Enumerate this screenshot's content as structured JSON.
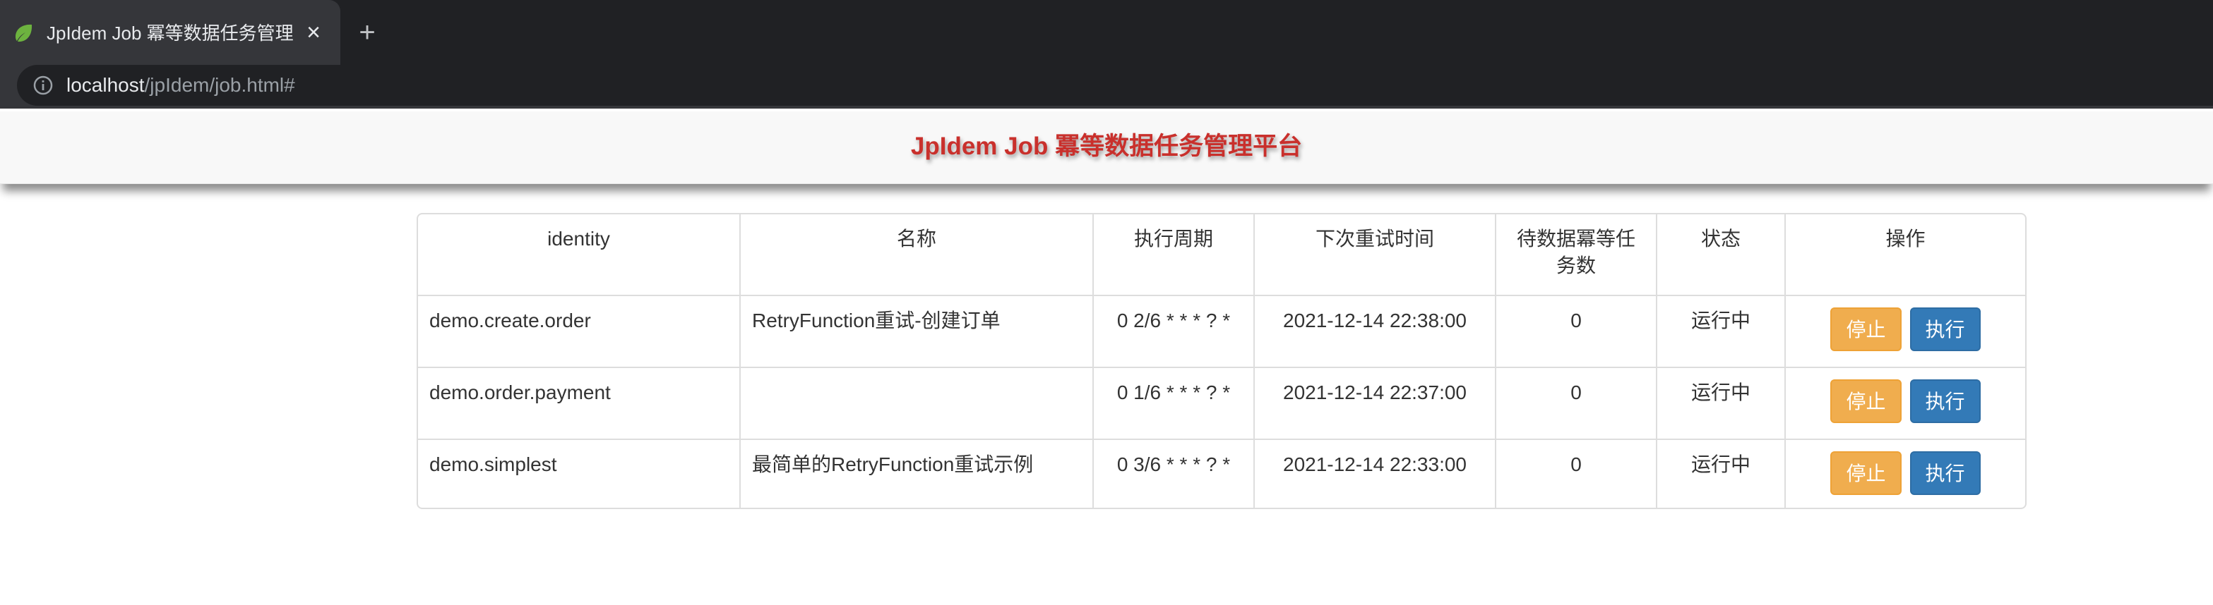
{
  "browser": {
    "tab_title": "JpIdem Job 冪等数据任务管理平台",
    "tab_close": "×",
    "new_tab": "+",
    "url_host": "localhost",
    "url_path": "/jpIdem/job.html#"
  },
  "page": {
    "title": "JpIdem Job 冪等数据任务管理平台"
  },
  "table": {
    "headers": {
      "identity": "identity",
      "name": "名称",
      "cron": "执行周期",
      "next_retry": "下次重试时间",
      "pending": "待数据冪等任务数",
      "status": "状态",
      "ops": "操作"
    },
    "rows": [
      {
        "identity": "demo.create.order",
        "name": "RetryFunction重试-创建订单",
        "cron": "0 2/6 * * * ? *",
        "next_retry": "2021-12-14 22:38:00",
        "pending": "0",
        "status": "运行中",
        "stop_label": "停止",
        "run_label": "执行"
      },
      {
        "identity": "demo.order.payment",
        "name": "",
        "cron": "0 1/6 * * * ? *",
        "next_retry": "2021-12-14 22:37:00",
        "pending": "0",
        "status": "运行中",
        "stop_label": "停止",
        "run_label": "执行"
      },
      {
        "identity": "demo.simplest",
        "name": "最简单的RetryFunction重试示例",
        "cron": "0 3/6 * * * ? *",
        "next_retry": "2021-12-14 22:33:00",
        "pending": "0",
        "status": "运行中",
        "stop_label": "停止",
        "run_label": "执行"
      }
    ]
  },
  "icons": {
    "favicon": "spring-leaf-icon",
    "info": "info-icon",
    "close": "close-icon",
    "new_tab": "plus-icon"
  },
  "colors": {
    "title_red": "#c9302c",
    "btn_warning": "#f0ad4e",
    "btn_primary": "#337ab7",
    "chrome_dark": "#202124",
    "chrome_tab": "#35363a"
  }
}
